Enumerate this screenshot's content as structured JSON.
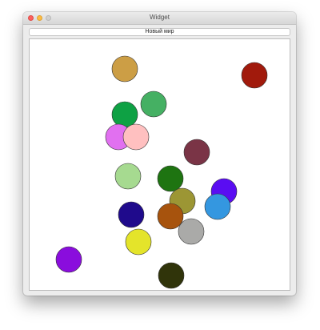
{
  "window": {
    "title": "Widget"
  },
  "toolbar": {
    "new_world_label": "Новый мир"
  },
  "world": {
    "balls": [
      {
        "color": "#cc9e45"
      },
      {
        "color": "#a11a0c"
      },
      {
        "color": "#45b063"
      },
      {
        "color": "#0ea144"
      },
      {
        "color": "#e170f0"
      },
      {
        "color": "#ffc0c0"
      },
      {
        "color": "#7a3446"
      },
      {
        "color": "#a6da90"
      },
      {
        "color": "#1e7411"
      },
      {
        "color": "#5a0df2"
      },
      {
        "color": "#9c9634"
      },
      {
        "color": "#3497e0"
      },
      {
        "color": "#1f0a8c"
      },
      {
        "color": "#a7530d"
      },
      {
        "color": "#aaaaa8"
      },
      {
        "color": "#e4e42a"
      },
      {
        "color": "#8a0ddd"
      },
      {
        "color": "#30340a"
      }
    ]
  }
}
